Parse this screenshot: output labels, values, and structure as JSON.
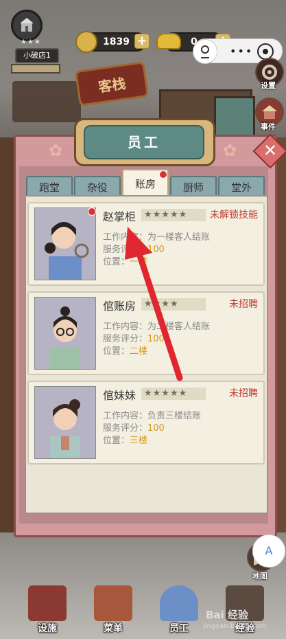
{
  "top_bar": {
    "shop_name": "小破店1",
    "coins": "1839",
    "ingots": "0",
    "plus": "+"
  },
  "scene": {
    "sign": "客栈"
  },
  "side_buttons": [
    {
      "label": "设置"
    },
    {
      "label": "事件"
    },
    {
      "label": "地图"
    }
  ],
  "panel": {
    "title": "员工",
    "close": "✕",
    "tabs": [
      {
        "label": "跑堂"
      },
      {
        "label": "杂役"
      },
      {
        "label": "账房"
      },
      {
        "label": "厨师"
      },
      {
        "label": "堂外"
      }
    ],
    "active_tab": "账房",
    "staff": [
      {
        "name": "赵掌柜",
        "stars": "★★★★★",
        "status": "未解锁技能",
        "work_label": "工作内容：",
        "work": "为一楼客人结账",
        "rating_label": "服务评分：",
        "rating": "100",
        "location_label": "位置：",
        "location": "一楼"
      },
      {
        "name": "倌账房",
        "stars": "★★★★",
        "status": "未招聘",
        "work_label": "工作内容：",
        "work": "为二楼客人结账",
        "rating_label": "服务评分：",
        "rating": "100",
        "location_label": "位置：",
        "location": "二楼"
      },
      {
        "name": "倌妹妹",
        "stars": "★★★★★",
        "status": "未招聘",
        "work_label": "工作内容：",
        "work": "负责三楼结账",
        "rating_label": "服务评分：",
        "rating": "100",
        "location_label": "位置：",
        "location": "三楼"
      }
    ]
  },
  "bottom_nav": [
    {
      "label": "设施"
    },
    {
      "label": "菜单"
    },
    {
      "label": "员工"
    },
    {
      "label": "经验"
    }
  ],
  "watermark": {
    "text": "Bai 经验",
    "url": "jingyan.baidu.com"
  },
  "colors": {
    "accent_red": "#c0392b",
    "highlight": "#d69a1c",
    "panel": "#d39a9e",
    "title_plate": "#5d8a85"
  }
}
